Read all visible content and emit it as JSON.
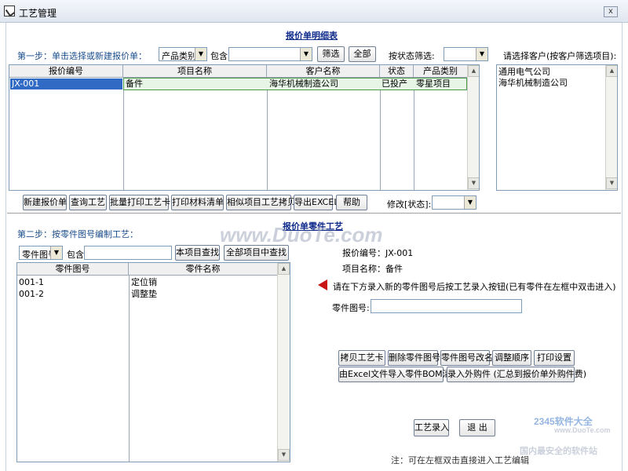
{
  "window": {
    "title": "工艺管理",
    "close_label": "x"
  },
  "top": {
    "section_title": "报价单明细表",
    "step1_label": "第一步：单击选择或新建报价单：",
    "category_select": "产品类别",
    "contains_label": "包含",
    "contains_value": "",
    "filter_button": "筛选",
    "all_button": "全部",
    "status_filter_label": "按状态筛选:",
    "status_filter_value": "",
    "customer_panel_label": "请选择客户(按客户筛选项目):",
    "customers": [
      "通用电气公司",
      "海华机械制造公司"
    ],
    "table": {
      "columns": [
        "报价编号",
        "项目名称",
        "客户名称",
        "状态",
        "产品类别"
      ],
      "rows": [
        {
          "id": "JX-001",
          "project": "备件",
          "customer": "海华机械制造公司",
          "status": "已投产",
          "category": "零星项目"
        }
      ]
    },
    "buttons": {
      "new_quote": "新建报价单",
      "query_process": "查询工艺",
      "batch_print": "批量打印工艺卡",
      "print_materials": "打印材料清单",
      "copy_similar": "相似项目工艺拷贝",
      "export_excel": "导出EXCEL",
      "help": "帮助"
    },
    "modify_status_label": "修改[状态]:",
    "modify_status_value": ""
  },
  "bottom": {
    "section_title": "报价单零件工艺",
    "step2_label": "第二步：按零件图号编制工艺：",
    "part_select": "零件图号",
    "contains_label": "包含",
    "contains_value": "",
    "search_current": "本项目查找",
    "search_all": "全部项目中查找",
    "table": {
      "columns": [
        "零件图号",
        "零件名称"
      ],
      "rows": [
        {
          "part_no": "001-1",
          "part_name": "定位销"
        },
        {
          "part_no": "001-2",
          "part_name": "调整垫"
        }
      ]
    },
    "quote_no_label": "报价编号：JX-001",
    "project_name_label": "项目名称：备件",
    "hint": "请在下方录入新的零件图号后按工艺录入按钮(已有零件在左框中双击进入)",
    "part_no_label": "零件图号:",
    "part_no_value": "",
    "buttons": {
      "copy_card": "拷贝工艺卡",
      "delete_part": "删除零件图号",
      "rename_part": "零件图号改名",
      "adjust_order": "调整顺序",
      "print_settings": "打印设置",
      "import_bom": "由Excel文件导入零件BOM清单",
      "enter_purchased": "录入外购件 (汇总到报价单外购件费)",
      "process_entry": "工艺录入",
      "exit": "退 出"
    },
    "note": "注：可在左框双击直接进入工艺编辑"
  },
  "watermarks": {
    "center": "www.DuoTe.com",
    "brand": "2345软件大全",
    "brand_url": "www.DuoTe.com",
    "brand_sub": "国内最安全的软件站"
  }
}
